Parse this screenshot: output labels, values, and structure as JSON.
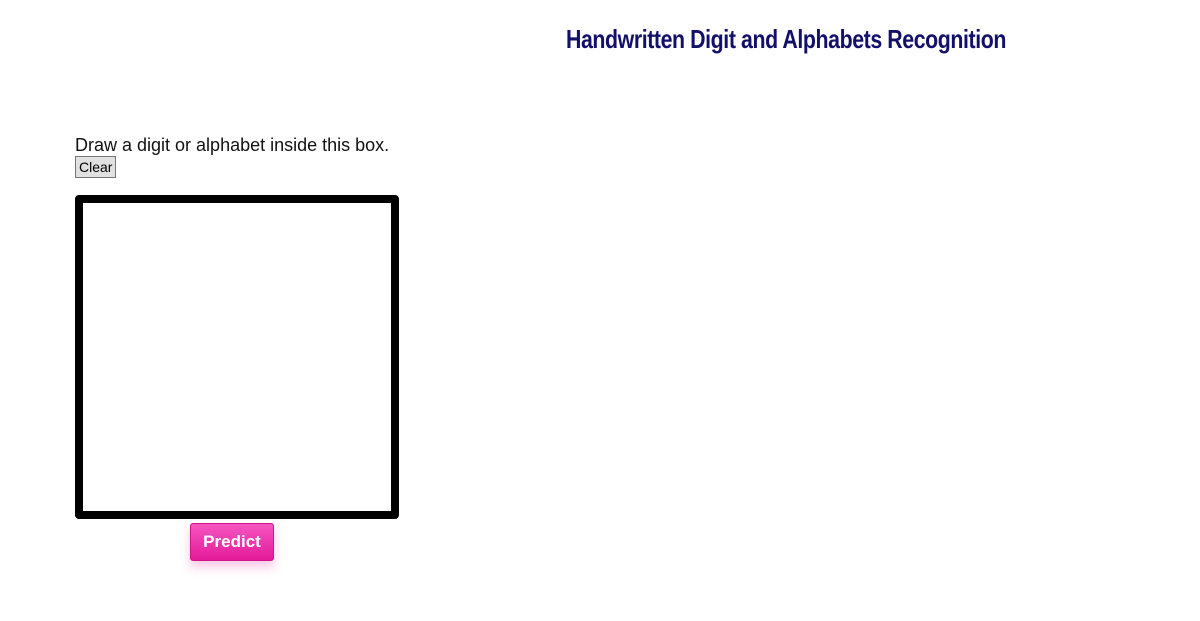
{
  "header": {
    "title": "Handwritten Digit and Alphabets Recognition"
  },
  "drawing": {
    "instructions": "Draw a digit or alphabet inside this box.",
    "clear_label": "Clear",
    "predict_label": "Predict"
  },
  "colors": {
    "title": "#12106b",
    "predict_button": "#e41a9a",
    "canvas_border": "#000000"
  }
}
